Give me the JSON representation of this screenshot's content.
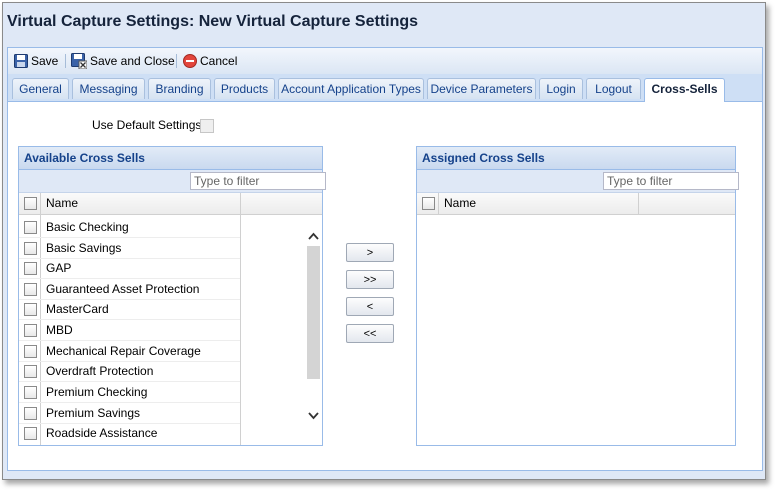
{
  "window": {
    "title": "Virtual Capture Settings: New Virtual Capture Settings"
  },
  "toolbar": {
    "save_label": "Save",
    "save_close_label": "Save and Close",
    "cancel_label": "Cancel"
  },
  "tabs": [
    {
      "label": "General"
    },
    {
      "label": "Messaging"
    },
    {
      "label": "Branding"
    },
    {
      "label": "Products"
    },
    {
      "label": "Account Application Types"
    },
    {
      "label": "Device Parameters"
    },
    {
      "label": "Login"
    },
    {
      "label": "Logout"
    },
    {
      "label": "Cross-Sells",
      "active": true
    }
  ],
  "settings": {
    "use_default_label": "Use Default Settings:",
    "use_default_checked": false
  },
  "available": {
    "title": "Available Cross Sells",
    "filter_placeholder": "Type to filter",
    "column_name": "Name",
    "items": [
      "Basic Checking",
      "Basic Savings",
      "GAP",
      "Guaranteed Asset Protection",
      "MasterCard",
      "MBD",
      "Mechanical Repair Coverage",
      "Overdraft Protection",
      "Premium Checking",
      "Premium Savings",
      "Roadside Assistance"
    ]
  },
  "assigned": {
    "title": "Assigned Cross Sells",
    "filter_placeholder": "Type to filter",
    "column_name": "Name",
    "items": []
  },
  "transfer": {
    "add_label": ">",
    "add_all_label": ">>",
    "remove_label": "<",
    "remove_all_label": "<<"
  },
  "colors": {
    "accent": "#15428b",
    "panel_border": "#99bbe8",
    "window_bg": "#dfe8f6"
  }
}
